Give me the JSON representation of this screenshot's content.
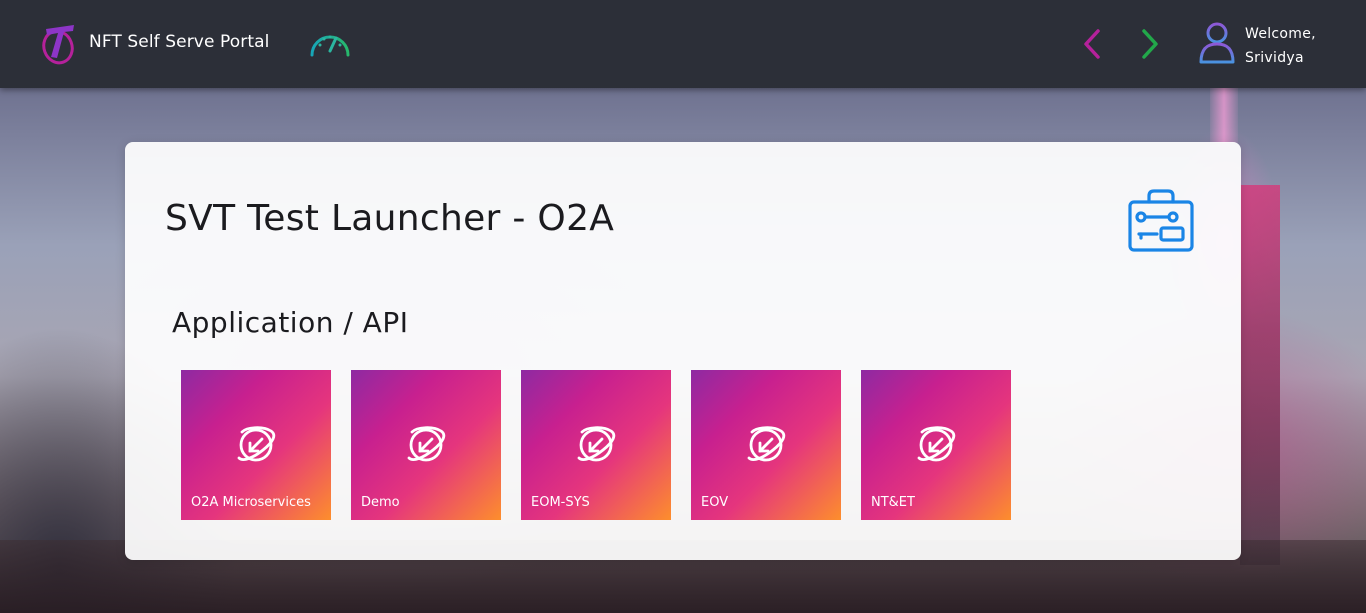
{
  "header": {
    "app_title": "NFT Self Serve Portal",
    "logo_icon": "telstra-logo-icon",
    "dashboard_icon": "speedometer-icon",
    "nav_back_icon": "chevron-left-icon",
    "nav_forward_icon": "chevron-right-icon",
    "user_icon": "user-avatar-icon",
    "welcome_label": "Welcome,",
    "user_name": "Srividya"
  },
  "main": {
    "title": "SVT Test Launcher - O2A",
    "title_icon": "toolkit-icon",
    "section_title": "Application / API",
    "tiles": [
      {
        "label": "O2A Microservices",
        "icon": "planet-link-icon"
      },
      {
        "label": "Demo",
        "icon": "planet-link-icon"
      },
      {
        "label": "EOM-SYS",
        "icon": "planet-link-icon"
      },
      {
        "label": "EOV",
        "icon": "planet-link-icon"
      },
      {
        "label": "NT&ET",
        "icon": "planet-link-icon"
      }
    ]
  },
  "colors": {
    "header_bg": "#2c2f38",
    "tile_gradient_start": "#8e2aa2",
    "tile_gradient_mid": "#e5357d",
    "tile_gradient_end": "#fd8e2c",
    "nav_back": "#b5219b",
    "nav_forward": "#22a84a",
    "toolkit_icon": "#1a85e6"
  }
}
